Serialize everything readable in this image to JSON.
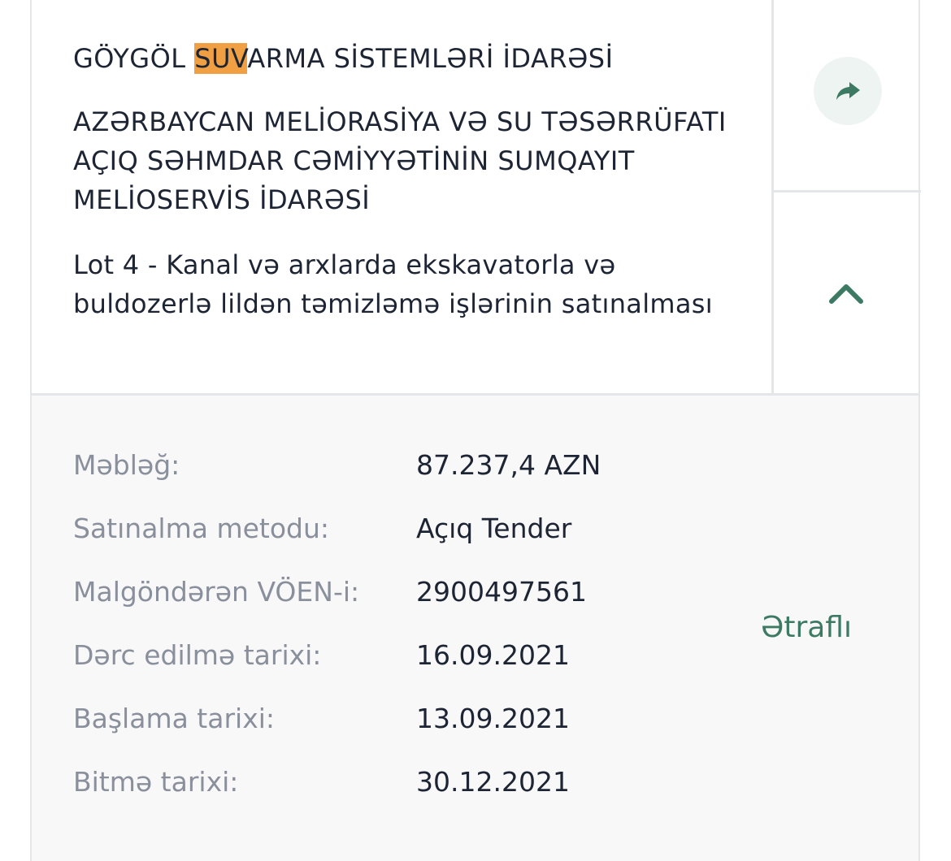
{
  "card": {
    "title_highlight": "SUV",
    "title_before": "GÖYGÖL ",
    "title_after": "ARMA SİSTEMLƏRİ İDARƏSİ",
    "buyer": "AZƏRBAYCAN MELİORASİYA VƏ SU TƏSƏRRÜFATI AÇIQ SƏHMDAR CƏMİYYƏTİNİN SUMQAYIT MELİOSERVİS İDARƏSİ",
    "lot": "Lot 4 - Kanal və arxlarda ekskavatorla və buldozerlə lildən təmizləmə işlərinin satınalması"
  },
  "details": {
    "rows": [
      {
        "label": "Məbləğ:",
        "value": "87.237,4 AZN"
      },
      {
        "label": "Satınalma metodu:",
        "value": "Açıq Tender"
      },
      {
        "label": "Malgöndərən VÖEN-i:",
        "value": "2900497561"
      },
      {
        "label": "Dərc edilmə tarixi:",
        "value": "16.09.2021"
      },
      {
        "label": "Başlama tarixi:",
        "value": "13.09.2021"
      },
      {
        "label": "Bitmə tarixi:",
        "value": "30.12.2021"
      }
    ],
    "more_label": "Ətraflı"
  },
  "icons": {
    "share": "share-arrow-icon",
    "collapse": "chevron-up-icon"
  },
  "colors": {
    "accent": "#3d7a63",
    "highlight": "#f0a042",
    "label": "#8a8f9c",
    "text": "#1d2433",
    "share_bg": "#eef4f1",
    "details_bg": "#f8f8f9"
  }
}
